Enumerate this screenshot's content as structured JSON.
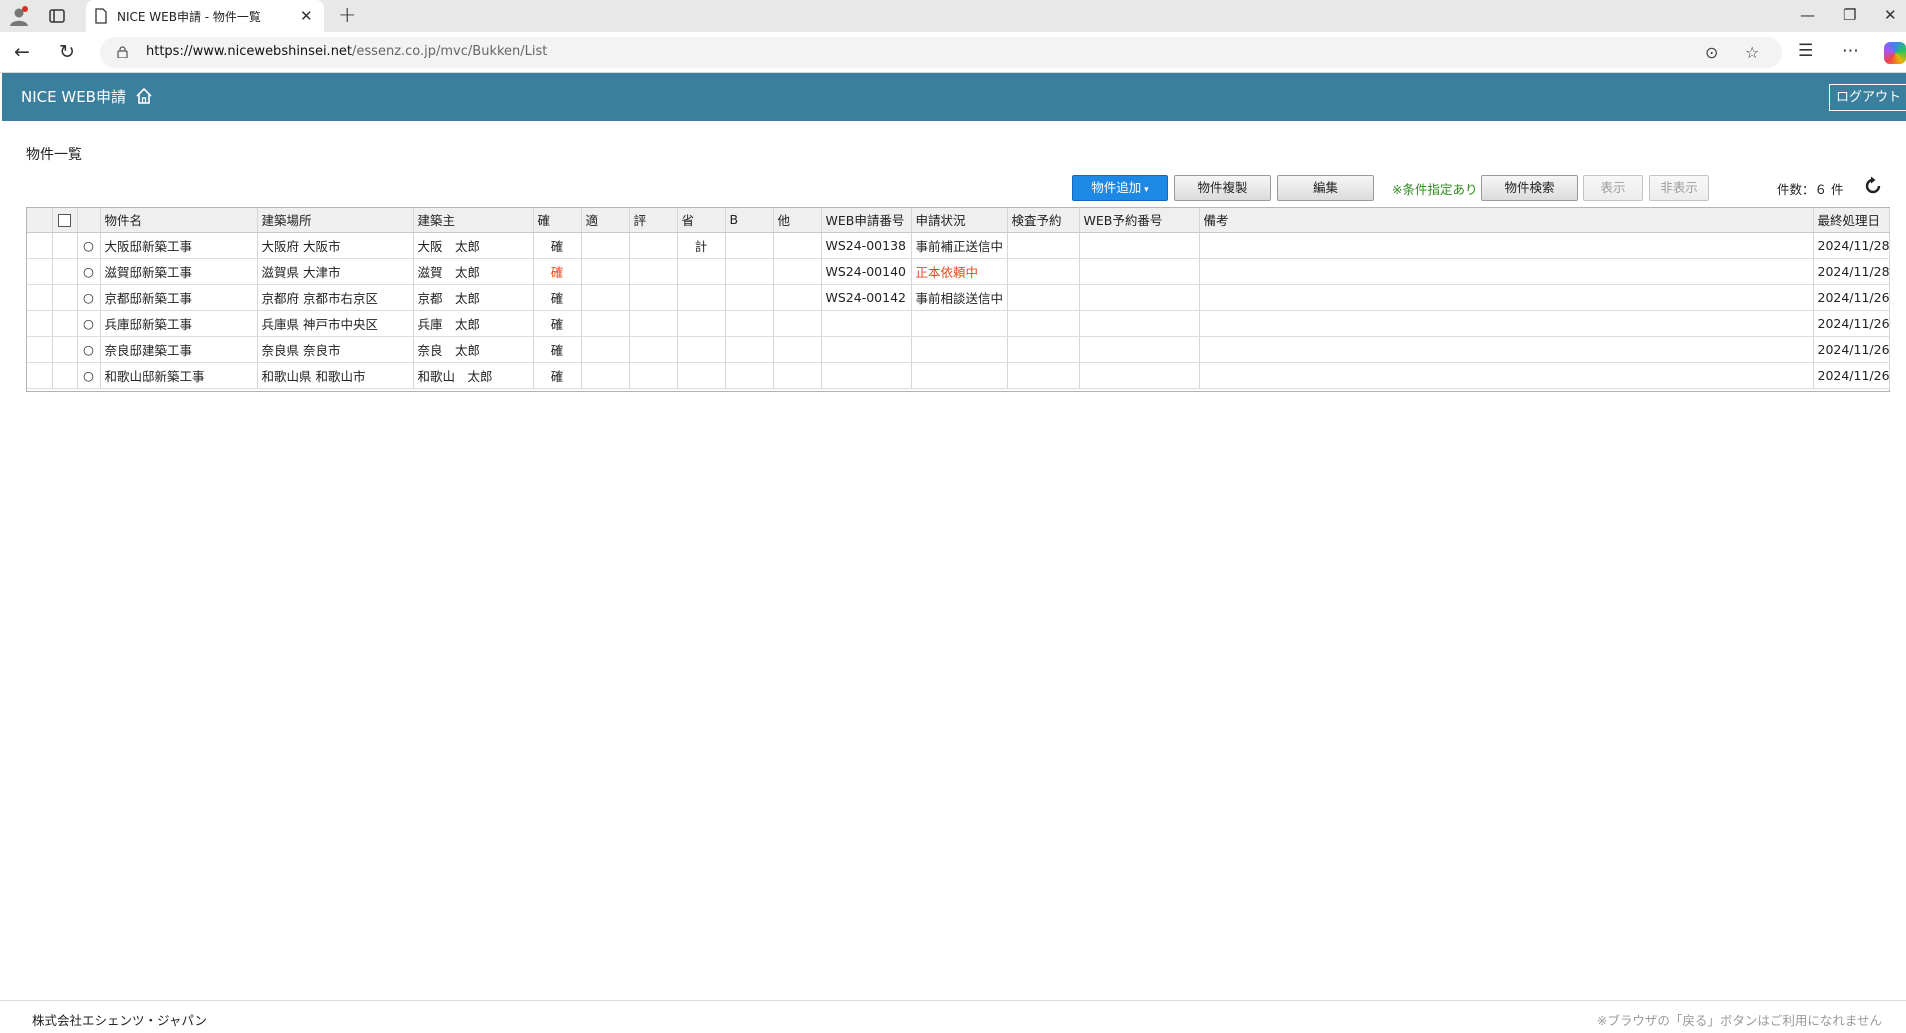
{
  "browser": {
    "tab_title": "NICE WEB申請 - 物件一覧",
    "url_host": "https://www.nicewebshinsei.net",
    "url_path": "/essenz.co.jp/mvc/Bukken/List"
  },
  "header": {
    "brand": "NICE WEB申請",
    "logout_label": "ログアウト"
  },
  "page": {
    "title": "物件一覧"
  },
  "toolbar": {
    "add_label": "物件追加",
    "copy_label": "物件複製",
    "edit_label": "編集",
    "condition_note": "※条件指定あり",
    "search_label": "物件検索",
    "show_label": "表示",
    "hide_label": "非表示",
    "count_text": "件数：６ 件"
  },
  "table": {
    "headers": {
      "name": "物件名",
      "location": "建築場所",
      "owner": "建築主",
      "kaku": "確",
      "teki": "適",
      "hyo": "評",
      "sho": "省",
      "b": "B",
      "ta": "他",
      "web_no": "WEB申請番号",
      "status": "申請状況",
      "inspect": "検査予約",
      "web_reserve": "WEB予約番号",
      "remarks": "備考",
      "last_date": "最終処理日"
    },
    "rows": [
      {
        "mark": "○",
        "name": "大阪邸新築工事",
        "location": "大阪府 大阪市",
        "owner": "大阪　太郎",
        "kaku": "確",
        "teki": "",
        "hyo": "",
        "sho": "計",
        "b": "",
        "ta": "",
        "web_no": "WS24-00138",
        "status": "事前補正送信中",
        "inspect": "",
        "web_reserve": "",
        "remarks": "",
        "last_date": "2024/11/28"
      },
      {
        "mark": "○",
        "name": "滋賀邸新築工事",
        "location": "滋賀県 大津市",
        "owner": "滋賀　太郎",
        "kaku": "確",
        "teki": "",
        "hyo": "",
        "sho": "",
        "b": "",
        "ta": "",
        "web_no": "WS24-00140",
        "status": "正本依頼中",
        "inspect": "",
        "web_reserve": "",
        "remarks": "",
        "last_date": "2024/11/28"
      },
      {
        "mark": "○",
        "name": "京都邸新築工事",
        "location": "京都府 京都市右京区",
        "owner": "京都　太郎",
        "kaku": "確",
        "teki": "",
        "hyo": "",
        "sho": "",
        "b": "",
        "ta": "",
        "web_no": "WS24-00142",
        "status": "事前相談送信中",
        "inspect": "",
        "web_reserve": "",
        "remarks": "",
        "last_date": "2024/11/26"
      },
      {
        "mark": "○",
        "name": "兵庫邸新築工事",
        "location": "兵庫県 神戸市中央区",
        "owner": "兵庫　太郎",
        "kaku": "確",
        "teki": "",
        "hyo": "",
        "sho": "",
        "b": "",
        "ta": "",
        "web_no": "",
        "status": "",
        "inspect": "",
        "web_reserve": "",
        "remarks": "",
        "last_date": "2024/11/26"
      },
      {
        "mark": "○",
        "name": "奈良邸建築工事",
        "location": "奈良県 奈良市",
        "owner": "奈良　太郎",
        "kaku": "確",
        "teki": "",
        "hyo": "",
        "sho": "",
        "b": "",
        "ta": "",
        "web_no": "",
        "status": "",
        "inspect": "",
        "web_reserve": "",
        "remarks": "",
        "last_date": "2024/11/26"
      },
      {
        "mark": "○",
        "name": "和歌山邸新築工事",
        "location": "和歌山県 和歌山市",
        "owner": "和歌山　太郎",
        "kaku": "確",
        "teki": "",
        "hyo": "",
        "sho": "",
        "b": "",
        "ta": "",
        "web_no": "",
        "status": "",
        "inspect": "",
        "web_reserve": "",
        "remarks": "",
        "last_date": "2024/11/26"
      }
    ]
  },
  "footer": {
    "company": "株式会社エシェンツ・ジャパン",
    "notice": "※ブラウザの「戻る」ボタンはご利用になれません"
  },
  "colors": {
    "header_bg": "#3a7f9e",
    "primary_button": "#1e88e5",
    "condition_note": "#2e8b1e",
    "alert_text": "#e8491a"
  }
}
